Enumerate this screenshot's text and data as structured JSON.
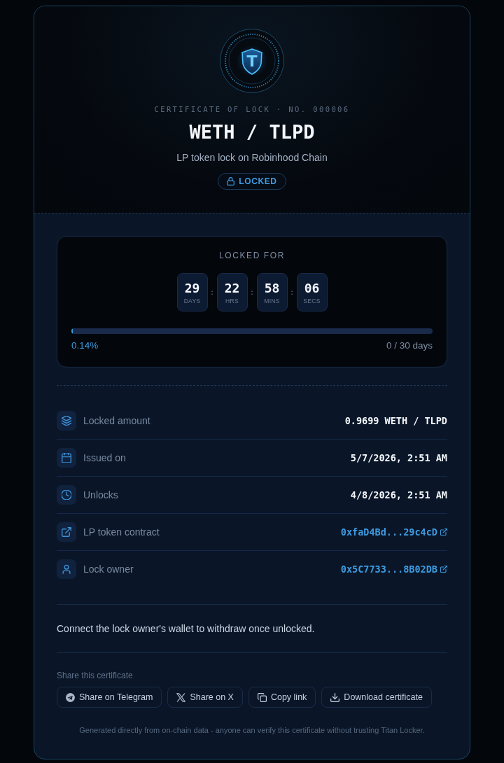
{
  "certificate": {
    "logo_letter": "T",
    "label": "CERTIFICATE OF LOCK · NO. 000006",
    "pair": "WETH / TLPD",
    "subtitle": "LP token lock on Robinhood Chain",
    "status": {
      "kind": "locked",
      "label": "LOCKED"
    }
  },
  "countdown": {
    "title": "LOCKED FOR",
    "units": [
      {
        "value": "29",
        "label": "DAYS"
      },
      {
        "value": "22",
        "label": "HRS"
      },
      {
        "value": "58",
        "label": "MINS"
      },
      {
        "value": "06",
        "label": "SECS"
      }
    ],
    "separators": [
      ":",
      ":",
      ":"
    ],
    "progress": {
      "level": 0.0014,
      "percent": "0.14%",
      "elapsed": "0 / 30 days"
    }
  },
  "details": [
    {
      "kind": "text",
      "label": "Locked amount",
      "value": "0.9699 WETH / TLPD"
    },
    {
      "kind": "text",
      "label": "Issued on",
      "value": "5/7/2026, 2:51 AM"
    },
    {
      "kind": "text",
      "label": "Unlocks",
      "value": "4/8/2026, 2:51 AM"
    },
    {
      "kind": "link",
      "label": "LP token contract",
      "value": "0xfaD4Bd...29c4cD"
    },
    {
      "kind": "link",
      "label": "Lock owner",
      "value": "0x5C7733...8B02DB"
    }
  ],
  "notice": "Connect the lock owner's wallet to withdraw once unlocked.",
  "share": {
    "title": "Share this certificate",
    "buttons": [
      {
        "label": "Share on Telegram"
      },
      {
        "label": "Share on X"
      },
      {
        "label": "Copy link"
      },
      {
        "label": "Download certificate"
      }
    ]
  },
  "footer": "Generated directly from on-chain data - anyone can verify this certificate without trusting Titan Locker."
}
